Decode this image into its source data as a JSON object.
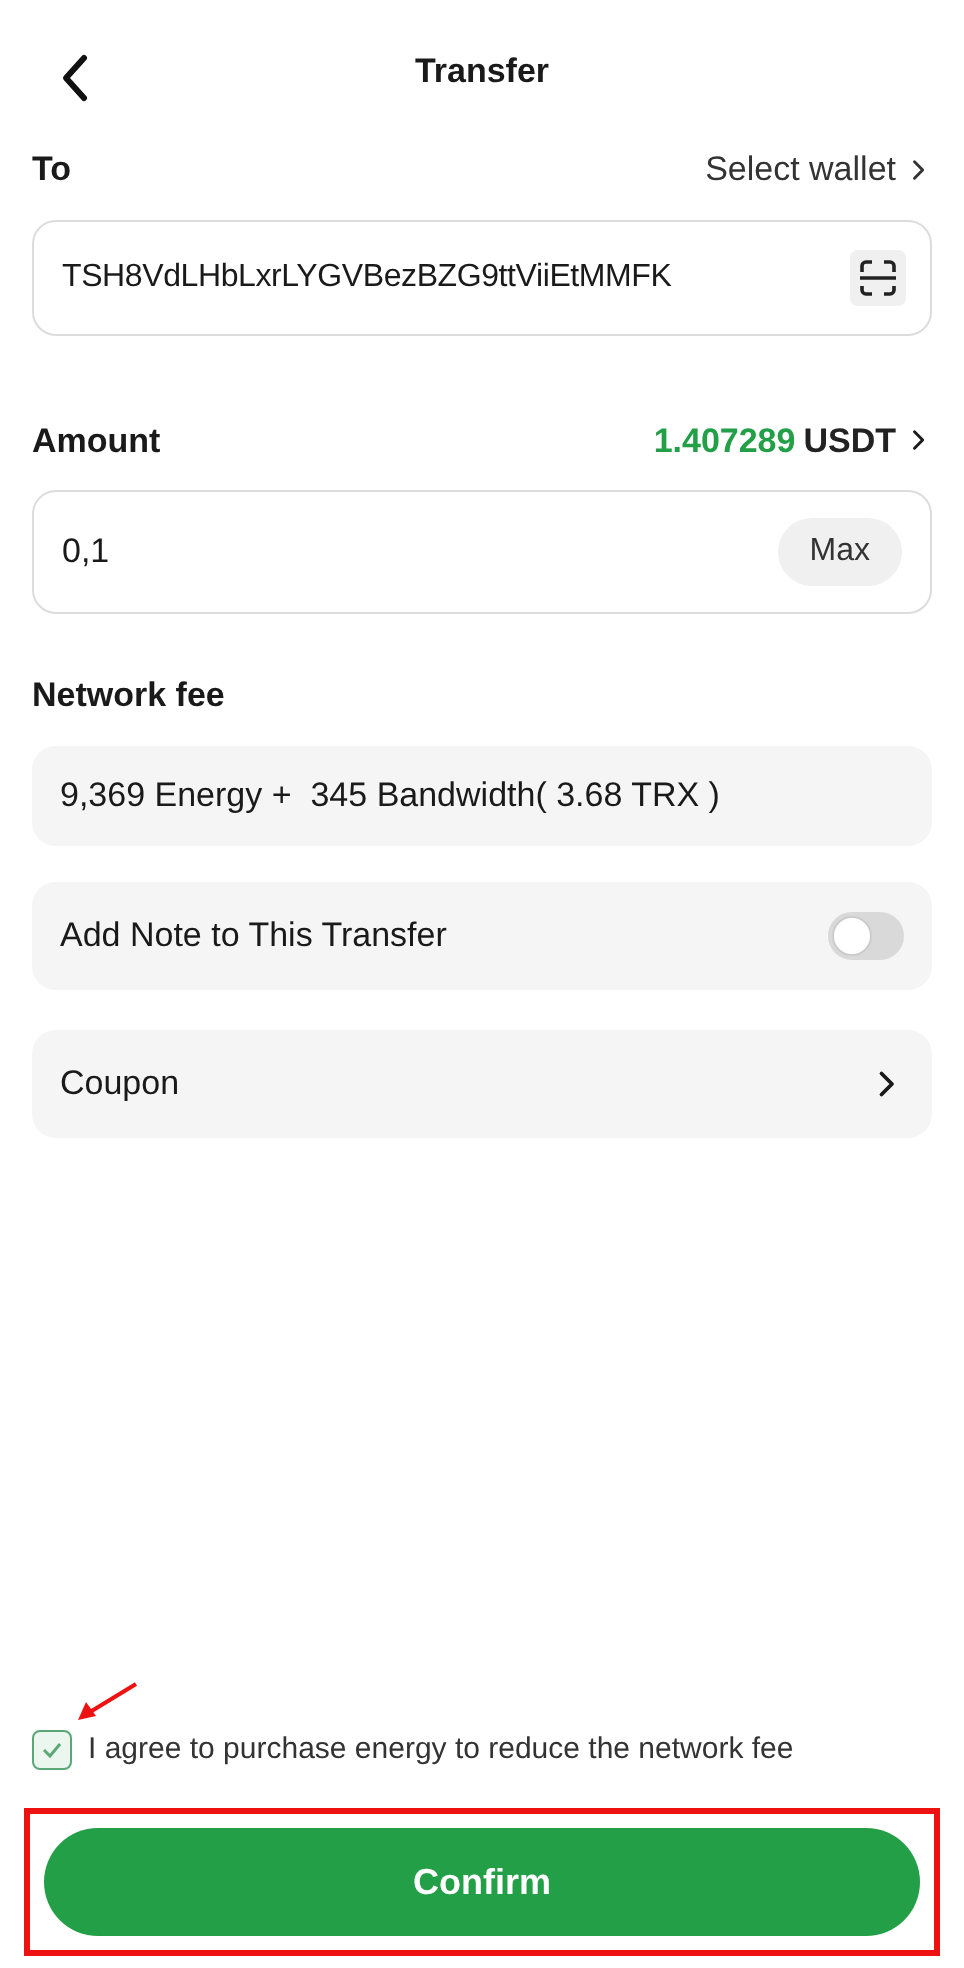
{
  "header": {
    "title": "Transfer"
  },
  "to": {
    "label": "To",
    "select_label": "Select wallet",
    "address": "TSH8VdLHbLxrLYGVBezBZG9ttViiEtMMFK"
  },
  "amount": {
    "label": "Amount",
    "balance": "1.407289",
    "currency": "USDT",
    "value": "0,1",
    "max_label": "Max"
  },
  "fee": {
    "label": "Network fee",
    "value": "9,369 Energy +  345 Bandwidth( 3.68 TRX )"
  },
  "note": {
    "label": "Add Note to This Transfer",
    "on": false
  },
  "coupon": {
    "label": "Coupon"
  },
  "agreement": {
    "text": "I agree to purchase energy to reduce the network fee",
    "checked": true
  },
  "confirm": {
    "label": "Confirm"
  },
  "annotations": {
    "arrow": true,
    "frame": true
  }
}
